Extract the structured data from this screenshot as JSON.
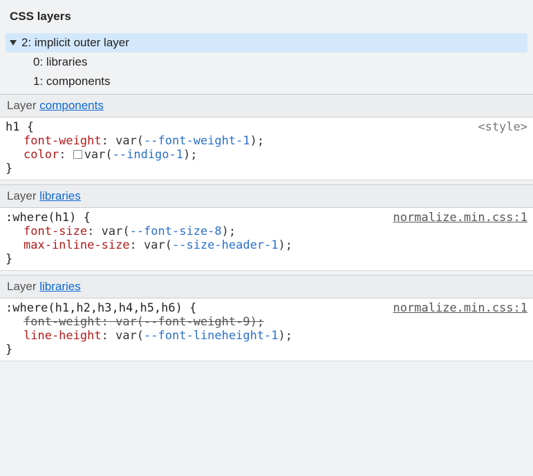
{
  "panel": {
    "title": "CSS layers"
  },
  "tree": {
    "root": {
      "label": "2: implicit outer layer"
    },
    "children": [
      {
        "label": "0: libraries"
      },
      {
        "label": "1: components"
      }
    ]
  },
  "layerWord": "Layer",
  "layers": [
    {
      "name": "components",
      "rule": {
        "selector": "h1",
        "openBrace": "{",
        "closeBrace": "}",
        "source": "<style>",
        "sourceLinked": false,
        "declarations": [
          {
            "prop": "font-weight",
            "colon": ":",
            "prefix": " var(",
            "var": "--font-weight-1",
            "suffix": ")",
            "semi": ";",
            "swatch": false,
            "strike": false
          },
          {
            "prop": "color",
            "colon": ":",
            "prefix": " var(",
            "var": "--indigo-1",
            "suffix": ")",
            "semi": ";",
            "swatch": true,
            "strike": false
          }
        ]
      }
    },
    {
      "name": "libraries",
      "rule": {
        "selector": ":where(h1)",
        "openBrace": "{",
        "closeBrace": "}",
        "source": "normalize.min.css:1",
        "sourceLinked": true,
        "declarations": [
          {
            "prop": "font-size",
            "colon": ":",
            "prefix": " var(",
            "var": "--font-size-8",
            "suffix": ")",
            "semi": ";",
            "swatch": false,
            "strike": false
          },
          {
            "prop": "max-inline-size",
            "colon": ":",
            "prefix": " var(",
            "var": "--size-header-1",
            "suffix": ")",
            "semi": ";",
            "swatch": false,
            "strike": false
          }
        ]
      }
    },
    {
      "name": "libraries",
      "rule": {
        "selector": ":where(h1,h2,h3,h4,h5,h6)",
        "openBrace": "{",
        "closeBrace": "}",
        "source": "normalize.min.css:1",
        "sourceLinked": true,
        "declarations": [
          {
            "prop": "font-weight",
            "colon": ":",
            "prefix": " var(",
            "var": "--font-weight-9",
            "suffix": ")",
            "semi": ";",
            "swatch": false,
            "strike": true
          },
          {
            "prop": "line-height",
            "colon": ":",
            "prefix": " var(",
            "var": "--font-lineheight-1",
            "suffix": ")",
            "semi": ";",
            "swatch": false,
            "strike": false
          }
        ]
      }
    }
  ]
}
